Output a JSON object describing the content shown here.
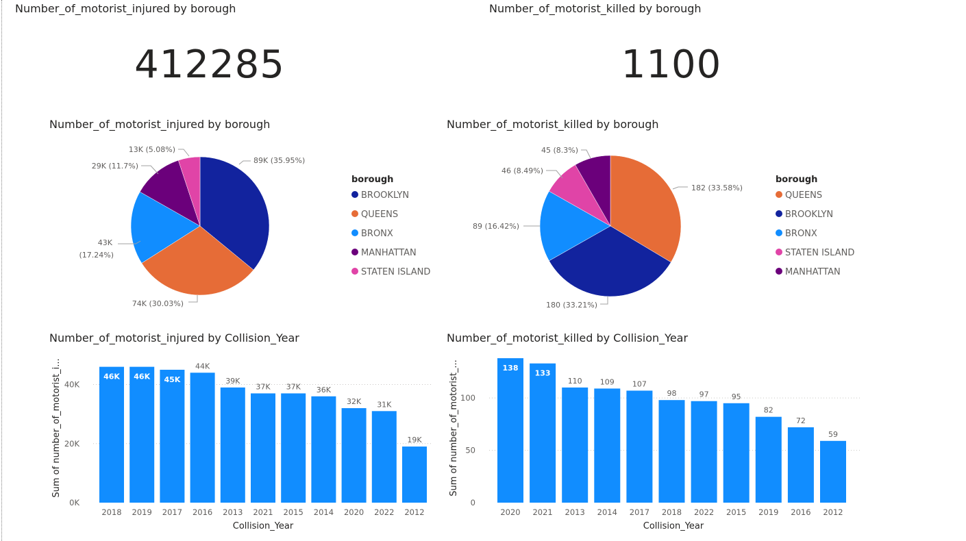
{
  "kpis": [
    {
      "title": "Number_of_motorist_injured by borough",
      "value": "412285"
    },
    {
      "title": "Number_of_motorist_killed by borough",
      "value": "1100"
    }
  ],
  "colors": {
    "BROOKLYN": "#12239e",
    "QUEENS": "#e66c37",
    "BRONX": "#118dff",
    "MANHATTAN": "#6b007b",
    "STATEN ISLAND": "#e044a7",
    "bar": "#118dff"
  },
  "chart_data": [
    {
      "type": "pie",
      "title": "Number_of_motorist_injured by borough",
      "legend_title": "borough",
      "legend_position": "right",
      "slices": [
        {
          "name": "BROOKLYN",
          "value": 89000,
          "percent": 35.95,
          "label": "89K (35.95%)"
        },
        {
          "name": "QUEENS",
          "value": 74000,
          "percent": 30.03,
          "label": "74K (30.03%)"
        },
        {
          "name": "BRONX",
          "value": 43000,
          "percent": 17.24,
          "label": "43K (17.24%)"
        },
        {
          "name": "MANHATTAN",
          "value": 29000,
          "percent": 11.7,
          "label": "29K (11.7%)"
        },
        {
          "name": "STATEN ISLAND",
          "value": 13000,
          "percent": 5.08,
          "label": "13K (5.08%)"
        }
      ]
    },
    {
      "type": "pie",
      "title": "Number_of_motorist_killed by borough",
      "legend_title": "borough",
      "legend_position": "right",
      "slices": [
        {
          "name": "QUEENS",
          "value": 182,
          "percent": 33.58,
          "label": "182 (33.58%)"
        },
        {
          "name": "BROOKLYN",
          "value": 180,
          "percent": 33.21,
          "label": "180 (33.21%)"
        },
        {
          "name": "BRONX",
          "value": 89,
          "percent": 16.42,
          "label": "89 (16.42%)"
        },
        {
          "name": "STATEN ISLAND",
          "value": 46,
          "percent": 8.49,
          "label": "46 (8.49%)"
        },
        {
          "name": "MANHATTAN",
          "value": 45,
          "percent": 8.3,
          "label": "45 (8.3%)"
        }
      ]
    },
    {
      "type": "bar",
      "title": "Number_of_motorist_injured by Collision_Year",
      "xlabel": "Collision_Year",
      "ylabel": "Sum of number_of_motorist_i...",
      "ylim": [
        0,
        48000
      ],
      "yticks": [
        {
          "v": 0,
          "t": "0K"
        },
        {
          "v": 20000,
          "t": "20K"
        },
        {
          "v": 40000,
          "t": "40K"
        }
      ],
      "grid": true,
      "categories": [
        "2018",
        "2019",
        "2017",
        "2016",
        "2013",
        "2021",
        "2015",
        "2014",
        "2020",
        "2022",
        "2012"
      ],
      "values": [
        46000,
        46000,
        45000,
        44000,
        39000,
        37000,
        37000,
        36000,
        32000,
        31000,
        19000
      ],
      "labels": [
        "46K",
        "46K",
        "45K",
        "44K",
        "39K",
        "37K",
        "37K",
        "36K",
        "32K",
        "31K",
        "19K"
      ]
    },
    {
      "type": "bar",
      "title": "Number_of_motorist_killed by Collision_Year",
      "xlabel": "Collision_Year",
      "ylabel": "Sum of number_of_motorist_...",
      "ylim": [
        0,
        140
      ],
      "yticks": [
        {
          "v": 0,
          "t": "0"
        },
        {
          "v": 50,
          "t": "50"
        },
        {
          "v": 100,
          "t": "100"
        }
      ],
      "grid": true,
      "categories": [
        "2020",
        "2021",
        "2013",
        "2014",
        "2017",
        "2018",
        "2022",
        "2015",
        "2019",
        "2016",
        "2012"
      ],
      "values": [
        138,
        133,
        110,
        109,
        107,
        98,
        97,
        95,
        82,
        72,
        59
      ],
      "labels": [
        "138",
        "133",
        "110",
        "109",
        "107",
        "98",
        "97",
        "95",
        "82",
        "72",
        "59"
      ]
    }
  ]
}
